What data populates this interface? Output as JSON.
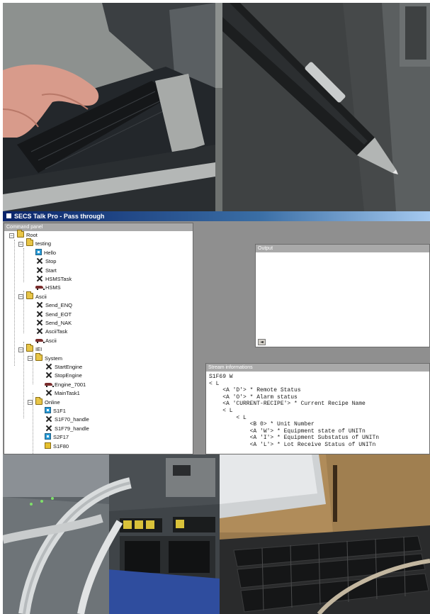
{
  "app": {
    "title": "SECS Talk Pro - Pass through",
    "command_panel_title": "Command panel",
    "output_title": "Output",
    "stream_title": "Stream informations"
  },
  "tree": [
    {
      "label": "Root",
      "icon": "folder-icon",
      "expanded": true
    },
    {
      "label": "testing",
      "icon": "folder-icon",
      "expanded": true
    },
    {
      "label": "Hello",
      "icon": "message-icon"
    },
    {
      "label": "Stop",
      "icon": "tools-icon"
    },
    {
      "label": "Start",
      "icon": "tools-icon"
    },
    {
      "label": "HSMSTask",
      "icon": "tools-icon"
    },
    {
      "label": "HSMS",
      "icon": "car-icon"
    },
    {
      "label": "Ascii",
      "icon": "folder-icon",
      "expanded": true
    },
    {
      "label": "Send_ENQ",
      "icon": "tools-icon"
    },
    {
      "label": "Send_EOT",
      "icon": "tools-icon"
    },
    {
      "label": "Send_NAK",
      "icon": "tools-icon"
    },
    {
      "label": "AsciiTask",
      "icon": "tools-icon"
    },
    {
      "label": "Ascii",
      "icon": "car-icon"
    },
    {
      "label": "IEI",
      "icon": "folder-icon",
      "expanded": true
    },
    {
      "label": "System",
      "icon": "folder-icon",
      "expanded": true
    },
    {
      "label": "StartEngine",
      "icon": "tools-icon"
    },
    {
      "label": "StopEngine",
      "icon": "tools-icon"
    },
    {
      "label": "Engine_7001",
      "icon": "car-icon"
    },
    {
      "label": "MainTask1",
      "icon": "tools-icon"
    },
    {
      "label": "Online",
      "icon": "folder-icon",
      "expanded": true
    },
    {
      "label": "S1F1",
      "icon": "message-icon"
    },
    {
      "label": "S1F70_handle",
      "icon": "tools-icon"
    },
    {
      "label": "S1F79_handle",
      "icon": "tools-icon"
    },
    {
      "label": "S2F17",
      "icon": "message-icon"
    },
    {
      "label": "S1F80",
      "icon": "message-yellow-icon"
    }
  ],
  "stream_lines": [
    "S1F69 W",
    "< L",
    "    <A 'D'> * Remote Status",
    "    <A 'O'> * Alarm status",
    "    <A 'CURRENT-RECIPE'> * Current Recipe Name",
    "    < L",
    "        < L",
    "            <B 0> * Unit Number",
    "            <A 'W'> * Equipment state of UNITn",
    "            <A 'I'> * Equipment Substatus of UNITn",
    "            <A 'L'> * Lot Receive Status of UNITn"
  ],
  "scroll_glyph": "◄",
  "expander_glyph": "−",
  "photos": {
    "top_left": "laptop-typing-photo",
    "top_right": "pen-photo",
    "bottom_left": "network-switch-photo",
    "bottom_right": "keyboard-photo"
  }
}
